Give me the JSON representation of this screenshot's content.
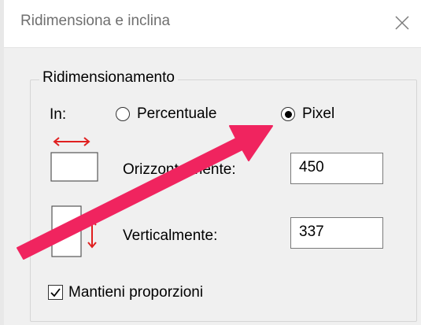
{
  "dialog": {
    "title": "Ridimensiona e inclina",
    "close_icon": "close-icon"
  },
  "resize": {
    "group_label": "Ridimensionamento",
    "in_label": "In:",
    "options": [
      {
        "label": "Percentuale",
        "selected": false
      },
      {
        "label": "Pixel",
        "selected": true
      }
    ],
    "horizontal": {
      "label": "Orizzontalmente:",
      "value": "450",
      "icon": "horizontal-resize-icon"
    },
    "vertical": {
      "label": "Verticalmente:",
      "value": "337",
      "icon": "vertical-resize-icon"
    },
    "keep_ratio": {
      "label": "Mantieni proporzioni",
      "checked": true
    }
  },
  "annotation": {
    "arrow_color": "#f0245f"
  },
  "colors": {
    "resize_arrow": "#e02020"
  }
}
